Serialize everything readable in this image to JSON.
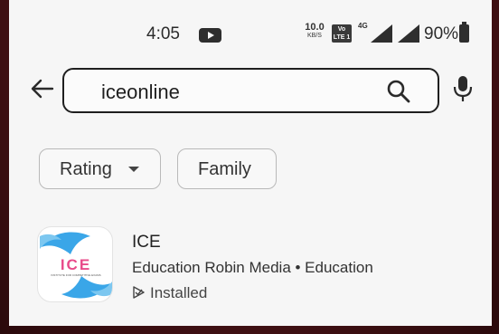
{
  "status_bar": {
    "time": "4:05",
    "net_speed_value": "10.0",
    "net_speed_unit": "KB/S",
    "volte_line1": "Vo",
    "volte_line2": "LTE 1",
    "network_type": "4G",
    "battery": "90%"
  },
  "search": {
    "query": "iceonline",
    "icons": {
      "back": "arrow-left-icon",
      "search": "search-icon",
      "mic": "mic-icon"
    }
  },
  "filters": [
    {
      "label": "Rating",
      "has_dropdown": true
    },
    {
      "label": "Family",
      "has_dropdown": false
    }
  ],
  "result": {
    "name": "ICE",
    "developer": "Robin Media",
    "category": "Education",
    "subtitle": "Education Robin Media • Education",
    "status": "Installed",
    "icon_logo_text": "ICE",
    "icon_tagline": "INSTITUTE FOR COMPETITIVE EXAMS"
  },
  "colors": {
    "accent_blue": "#3aa6e8",
    "logo_pink": "#e84b8a",
    "background": "#f6f6f6",
    "frame": "#4a1216"
  }
}
